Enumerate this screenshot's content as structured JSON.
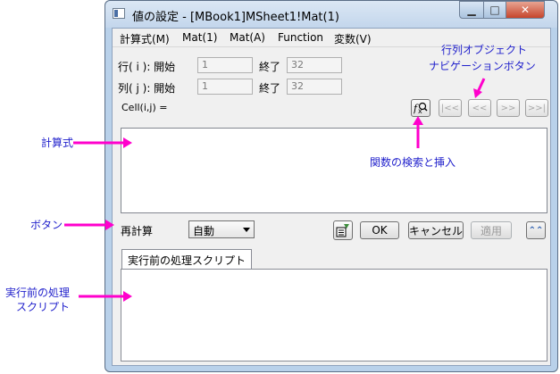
{
  "window": {
    "title": "値の設定 - [MBook1]MSheet1!Mat(1)",
    "min_glyph": "▁",
    "max_glyph": "□",
    "close_glyph": "✕"
  },
  "menu": [
    "計算式(M)",
    "Mat(1)",
    "Mat(A)",
    "Function",
    "変数(V)"
  ],
  "rows": {
    "row_label": "行( i ): 開始",
    "col_label": "列( j ): 開始",
    "end_label": "終了",
    "row_start": "1",
    "row_end": "32",
    "col_start": "1",
    "col_end": "32"
  },
  "cell_label": "Cell(i,j) =",
  "nav": {
    "first": "|<<",
    "prev": "<<",
    "next": ">>",
    "last": ">>|"
  },
  "recalc": {
    "label": "再計算",
    "value": "自動"
  },
  "buttons": {
    "ok": "OK",
    "cancel": "キャンセル",
    "apply": "適用",
    "collapse": "⌃⌃"
  },
  "tab_label": "実行前の処理スクリプト",
  "annotations": {
    "formula": "計算式",
    "nav_line1": "行列オブジェクト",
    "nav_line2": "ナビゲーションボタン",
    "search": "関数の検索と挿入",
    "button": "ボタン",
    "script_line1": "実行前の処理",
    "script_line2": "スクリプト"
  },
  "colors": {
    "annotation_text": "#2222cc",
    "arrow": "#ff00cc"
  }
}
